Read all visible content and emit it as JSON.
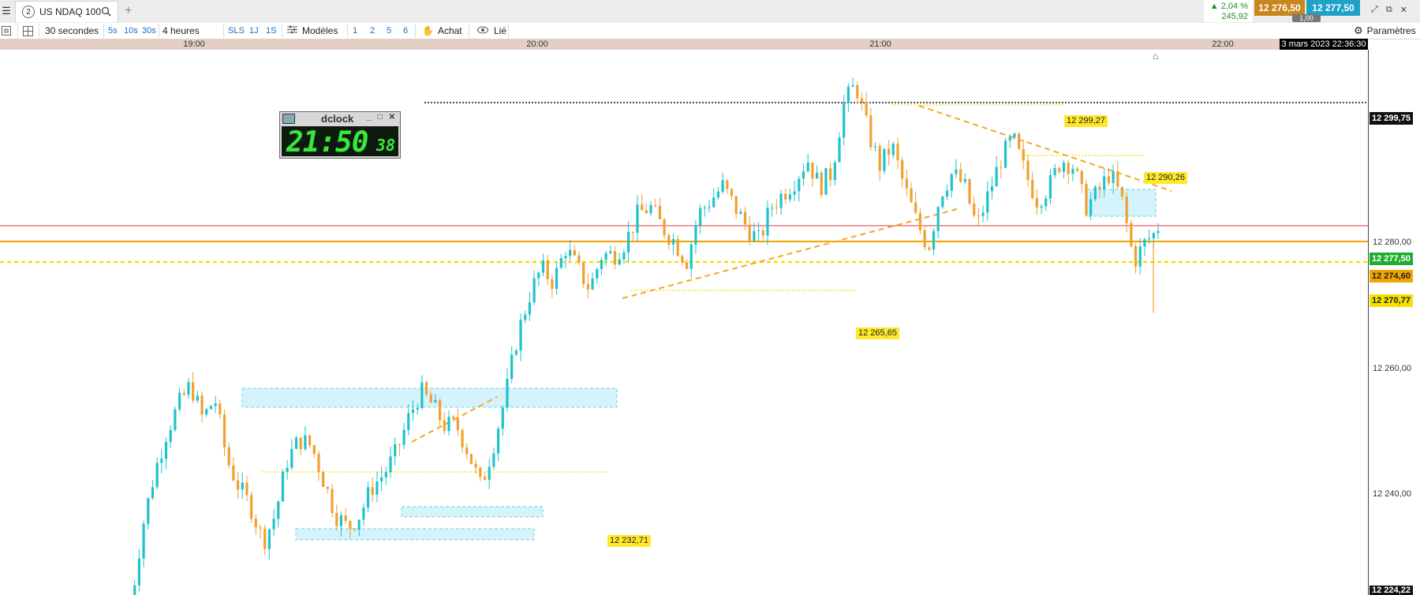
{
  "tabbar": {
    "tab_number": "2",
    "tab_name": "US NDAQ 100",
    "add_label": "+",
    "change_pct": "▲ 2,04 %",
    "change_abs": "245,92",
    "bid": "12 276,50",
    "ask": "12 277,50",
    "qty": "1,00"
  },
  "toolbar": {
    "interval": "30 secondes",
    "quick_intervals": [
      "5s",
      "10s",
      "30s"
    ],
    "range": "4 heures",
    "periods": [
      "SLS",
      "1J",
      "1S"
    ],
    "models": "Modèles",
    "layouts": [
      "1",
      "2",
      "5",
      "6"
    ],
    "buy": "Achat",
    "linked": "Lié",
    "settings": "Paramètres"
  },
  "timeaxis": {
    "labels": [
      "19:00",
      "20:00",
      "21:00",
      "22:00"
    ],
    "datestamp": "3 mars 2023 22:36:30"
  },
  "price_axis": {
    "ticks": [
      "12 280,00",
      "12 260,00",
      "12 240,00"
    ],
    "tags": {
      "top": "12 299,75",
      "last": "12 277,50",
      "orange": "12 274,60",
      "yellow": "12 270,77",
      "bottom": "12 224,22"
    }
  },
  "annotations": {
    "high": "12 299,27",
    "resistance": "12 290,26",
    "mid": "12 265,65",
    "low": "12 232,71"
  },
  "dclock": {
    "title": "dclock",
    "time": "21:50",
    "seconds": "38"
  },
  "colors": {
    "up": "#20c2cc",
    "down": "#f0a030",
    "last_line": "#e03a3a",
    "orange_line": "#f0a500",
    "yellow_line": "#f6e000",
    "zone": "#d5f3fb"
  },
  "chart_data": {
    "type": "candlestick",
    "ylim": [
      12224.22,
      12304
    ],
    "last_price": 12277.5,
    "levels": [
      12299.75,
      12277.5,
      12274.6,
      12270.77,
      12299.27,
      12290.26,
      12265.65,
      12232.71
    ],
    "close_path": [
      12222,
      12234,
      12242,
      12248,
      12252,
      12255,
      12250,
      12253,
      12244,
      12240,
      12237,
      12232,
      12236,
      12244,
      12247,
      12246,
      12241,
      12236,
      12234,
      12236,
      12240,
      12242,
      12245,
      12250,
      12254,
      12252,
      12249,
      12249,
      12245,
      12240,
      12246,
      12253,
      12262,
      12268,
      12272,
      12270,
      12275,
      12272,
      12269,
      12274,
      12274,
      12276,
      12280,
      12281,
      12278,
      12276,
      12273,
      12280,
      12282,
      12284,
      12281,
      12278,
      12276,
      12281,
      12283,
      12285,
      12288,
      12284,
      12286,
      12296,
      12299,
      12292,
      12287,
      12290,
      12284,
      12279,
      12275,
      12283,
      12286,
      12284,
      12278,
      12283,
      12288,
      12291,
      12286,
      12282,
      12284,
      12288,
      12287,
      12281,
      12283,
      12286,
      12282,
      12273,
      12276,
      12277.5
    ]
  }
}
